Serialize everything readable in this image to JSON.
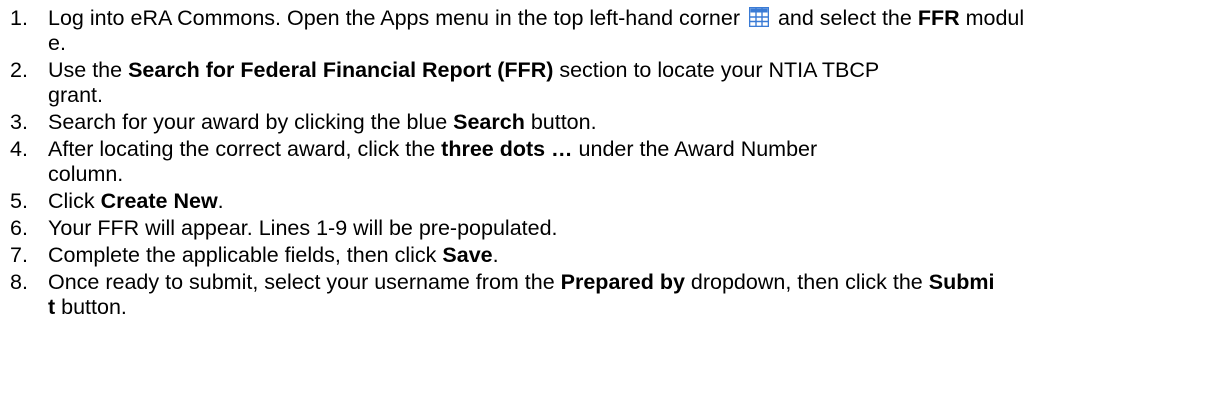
{
  "steps": [
    {
      "num": "1.",
      "parts": [
        {
          "t": "Log into eRA Commons. Open the Apps menu in the top left-hand corner "
        },
        {
          "icon": "apps-grid-icon"
        },
        {
          "t": " and select the "
        },
        {
          "b": "FFR"
        },
        {
          "t": " module."
        }
      ]
    },
    {
      "num": "2.",
      "parts": [
        {
          "t": "Use the "
        },
        {
          "b": "Search for Federal Financial Report (FFR)"
        },
        {
          "t": " section to locate your NTIA TBCP grant."
        }
      ]
    },
    {
      "num": "3.",
      "parts": [
        {
          "t": "Search for your award by clicking the blue "
        },
        {
          "b": "Search"
        },
        {
          "t": " button."
        }
      ]
    },
    {
      "num": "4.",
      "parts": [
        {
          "t": "After locating the correct award, click the "
        },
        {
          "b": "three dots …"
        },
        {
          "t": " under the Award Number column."
        }
      ]
    },
    {
      "num": "5.",
      "parts": [
        {
          "t": "Click "
        },
        {
          "b": "Create New"
        },
        {
          "t": "."
        }
      ]
    },
    {
      "num": "6.",
      "parts": [
        {
          "t": "Your FFR will appear. Lines 1-9 will be pre-populated."
        }
      ]
    },
    {
      "num": "7.",
      "parts": [
        {
          "t": "Complete the applicable fields, then click "
        },
        {
          "b": "Save"
        },
        {
          "t": "."
        }
      ]
    },
    {
      "num": "8.",
      "parts": [
        {
          "t": "Once ready to submit, select your username from the "
        },
        {
          "b": "Prepared by"
        },
        {
          "t": " dropdown, then click the "
        },
        {
          "b": "Submit"
        },
        {
          "t": " button."
        }
      ]
    }
  ],
  "colors": {
    "text": "#000000",
    "apps_icon": "#3a7bd5"
  }
}
